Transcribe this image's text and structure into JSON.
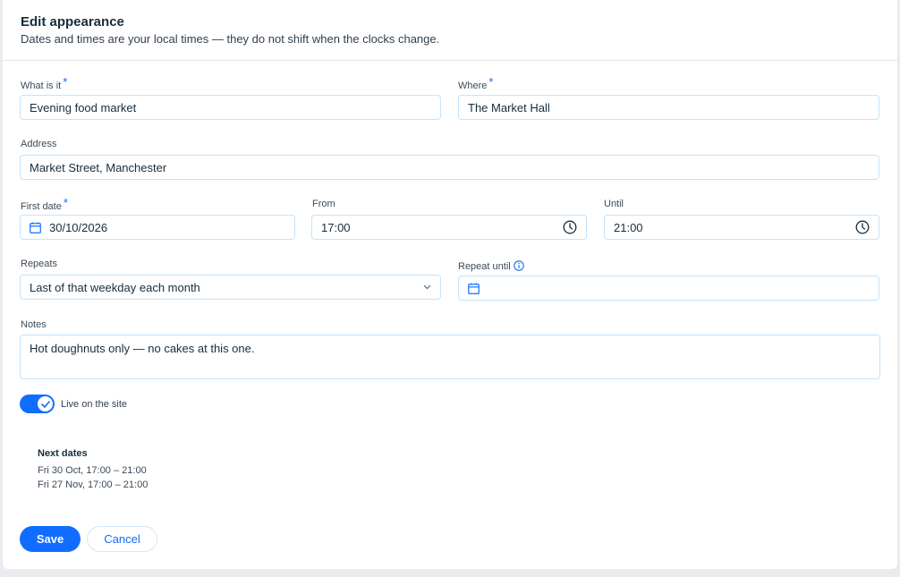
{
  "header": {
    "title": "Edit appearance",
    "subtitle": "Dates and times are your local times — they do not shift when the clocks change."
  },
  "fields": {
    "what": {
      "label": "What is it",
      "required": "*",
      "value": "Evening food market"
    },
    "where": {
      "label": "Where",
      "required": "*",
      "value": "The Market Hall"
    },
    "address": {
      "label": "Address",
      "value": "Market Street, Manchester"
    },
    "first_date": {
      "label": "First date",
      "required": "*",
      "value": "30/10/2026",
      "icon": "calendar-icon"
    },
    "from": {
      "label": "From",
      "value": "17:00",
      "icon": "clock-icon"
    },
    "until": {
      "label": "Until",
      "value": "21:00",
      "icon": "clock-icon"
    },
    "repeats": {
      "label": "Repeats",
      "value": "Last of that weekday each month",
      "icon": "chevron-down-icon"
    },
    "repeat_until": {
      "label": "Repeat until",
      "value": "",
      "icon": "calendar-icon",
      "info_icon": "info-icon"
    },
    "notes": {
      "label": "Notes",
      "value": "Hot doughnuts only — no cakes at this one."
    }
  },
  "toggle": {
    "label": "Live on the site",
    "on": true
  },
  "next_dates": {
    "title": "Next dates",
    "items": [
      "Fri 30 Oct, 17:00 – 21:00",
      "Fri 27 Nov, 17:00 – 21:00"
    ]
  },
  "buttons": {
    "save": "Save",
    "cancel": "Cancel"
  },
  "colors": {
    "accent": "#116dff",
    "border": "#c1e4fe",
    "text": "#162d3d"
  }
}
